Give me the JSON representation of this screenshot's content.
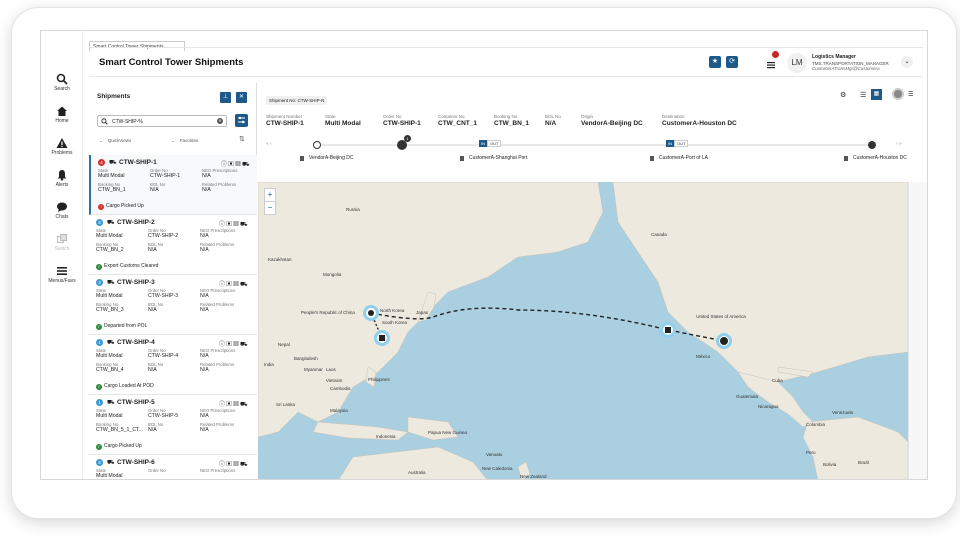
{
  "browser_tab": "Smart Control Tower Shipments",
  "header": {
    "title": "Smart Control Tower Shipments",
    "badge_count": "",
    "user": {
      "initials": "LM",
      "name": "Logistics Manager",
      "role": "TMS.TRANSPORTATION_MANAGER",
      "email": "CustomerATransMgr@Customera"
    }
  },
  "nav": [
    {
      "label": "Search",
      "icon": "search-icon"
    },
    {
      "label": "Home",
      "icon": "home-icon"
    },
    {
      "label": "Problems",
      "icon": "warning-icon"
    },
    {
      "label": "Alerts",
      "icon": "bell-icon"
    },
    {
      "label": "Chats",
      "icon": "chat-icon"
    },
    {
      "label": "Switch",
      "icon": "switch-icon"
    },
    {
      "label": "Menus/Favs",
      "icon": "menu-icon"
    }
  ],
  "panel": {
    "title": "Shipments",
    "search_value": "CTW-SHIP-%",
    "quick_views": "QuickViews",
    "favorites": "Favorites"
  },
  "shipments": [
    {
      "num": "4",
      "num_red": true,
      "id": "CTW-SHIP-1",
      "state": "Multi Modal",
      "order_no": "CTW-SHIP-1",
      "neo_prescriptions": "N/A",
      "booking_no": "CTW_BN_1",
      "bol_no": "N/A",
      "related_problems": "N/A",
      "status": "Cargo Picked Up",
      "status_red": true,
      "selected": true
    },
    {
      "num": "3",
      "num_red": false,
      "id": "CTW-SHIP-2",
      "state": "Multi Modal",
      "order_no": "CTW-SHIP-2",
      "neo_prescriptions": "N/A",
      "booking_no": "CTW_BN_2",
      "bol_no": "N/A",
      "related_problems": "N/A",
      "status": "Export Customs Cleared",
      "status_red": false,
      "selected": false
    },
    {
      "num": "3",
      "num_red": false,
      "id": "CTW-SHIP-3",
      "state": "Multi Modal",
      "order_no": "CTW-SHIP-3",
      "neo_prescriptions": "N/A",
      "booking_no": "CTW_BN_3",
      "bol_no": "N/A",
      "related_problems": "N/A",
      "status": "Departed from POL",
      "status_red": false,
      "selected": false
    },
    {
      "num": "1",
      "num_red": false,
      "id": "CTW-SHIP-4",
      "state": "Multi Modal",
      "order_no": "CTW-SHIP-4",
      "neo_prescriptions": "N/A",
      "booking_no": "CTW_BN_4",
      "bol_no": "N/A",
      "related_problems": "N/A",
      "status": "Cargo Loaded At POD",
      "status_red": false,
      "selected": false
    },
    {
      "num": "1",
      "num_red": false,
      "id": "CTW-SHIP-5",
      "state": "Multi Modal",
      "order_no": "CTW-SHIP-5",
      "neo_prescriptions": "N/A",
      "booking_no": "CTW_BN_5_1_CT...",
      "bol_no": "N/A",
      "related_problems": "N/A",
      "status": "Cargo Picked Up",
      "status_red": false,
      "selected": false
    },
    {
      "num": "3",
      "num_red": false,
      "id": "CTW-SHIP-6",
      "state": "Multi Modal",
      "order_no": "",
      "neo_prescriptions": "",
      "booking_no": "",
      "bol_no": "",
      "related_problems": "",
      "status": "",
      "status_red": false,
      "selected": false
    }
  ],
  "labels": {
    "state": "State",
    "order_no": "Order No",
    "neo_prescriptions": "NEO Prescriptions",
    "booking_no": "Booking No",
    "bol_no": "BOL No",
    "related_problems": "Related Problems"
  },
  "detail": {
    "chip": "Shipment No: CTW-SHIP-N",
    "fields": [
      {
        "label": "Shipment Number",
        "value": "CTW-SHIP-1"
      },
      {
        "label": "State",
        "value": "Multi Modal"
      },
      {
        "label": "Order No",
        "value": "CTW-SHIP-1"
      },
      {
        "label": "Container No",
        "value": "CTW_CNT_1"
      },
      {
        "label": "Booking No",
        "value": "CTW_BN_1"
      },
      {
        "label": "BOL No",
        "value": "N/A"
      },
      {
        "label": "Origin",
        "value": "VendorA-Beijing DC"
      },
      {
        "label": "Destination",
        "value": "CustomerA-Houston DC"
      }
    ],
    "in_label": "IN",
    "out_label": "OUT",
    "stop_badge": "1",
    "stops": [
      "VendorA-Beijing DC",
      "CustomerA-Shanghai Port",
      "CustomerA-Port of LA",
      "CustomerA-Houston DC"
    ]
  },
  "map": {
    "zoom_in": "+",
    "zoom_out": "−",
    "labels": [
      "Russia",
      "Canada",
      "United States of America",
      "México",
      "People's Republic of China",
      "North Korea",
      "South Korea",
      "Bangladesh",
      "India",
      "Myanmar",
      "Laos",
      "Cambodia",
      "Philippines",
      "Malaysia",
      "Indonesia",
      "Papua New Guinea",
      "Australia",
      "New Zealand",
      "New Caledonia",
      "Vanuatu",
      "Peru",
      "Bolivia",
      "Brazil",
      "Colombia",
      "Venezuela",
      "Sri Lanka",
      "Nepal",
      "Kazakhstan",
      "Mongolia",
      "Cuba",
      "Guatemala",
      "Nicaragua",
      "Vietnam",
      "Japan"
    ]
  }
}
